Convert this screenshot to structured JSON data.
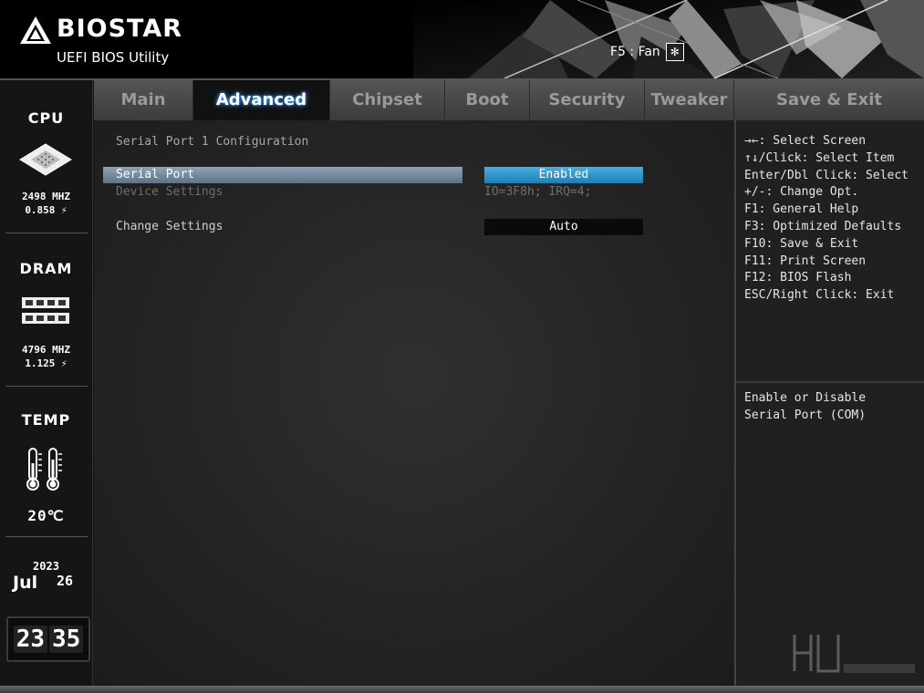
{
  "header": {
    "brand": "BIOSTAR",
    "subtitle": "UEFI BIOS Utility",
    "fan_label": "F5 : Fan"
  },
  "sidebar": {
    "cpu": {
      "label": "CPU",
      "freq": "2498 MHZ",
      "volt": "0.858 ⚡"
    },
    "dram": {
      "label": "DRAM",
      "freq": "4796 MHZ",
      "volt": "1.125 ⚡"
    },
    "temp": {
      "label": "TEMP",
      "value": "20℃"
    },
    "date": {
      "year": "2023",
      "month": "Jul",
      "day": "26"
    },
    "clock": {
      "hours": "23",
      "minutes": "35"
    }
  },
  "tabs": [
    {
      "label": "Main"
    },
    {
      "label": "Advanced"
    },
    {
      "label": "Chipset"
    },
    {
      "label": "Boot"
    },
    {
      "label": "Security"
    },
    {
      "label": "Tweaker"
    },
    {
      "label": "Save & Exit"
    }
  ],
  "main": {
    "section_title": "Serial Port 1 Configuration",
    "rows": [
      {
        "label": "Serial Port",
        "value": "Enabled"
      },
      {
        "label": "Device Settings",
        "value": "IO=3F8h; IRQ=4;"
      },
      {
        "label": "Change Settings",
        "value": "Auto"
      }
    ]
  },
  "help": {
    "keys": [
      "→←: Select Screen",
      "↑↓/Click: Select Item",
      "Enter/Dbl Click: Select",
      "+/-: Change Opt.",
      "F1: General Help",
      "F3: Optimized Defaults",
      "F10: Save & Exit",
      "F11: Print Screen",
      "F12: BIOS Flash",
      "ESC/Right Click: Exit"
    ],
    "description": [
      "Enable or Disable",
      "Serial Port (COM)"
    ]
  },
  "colors": {
    "accent_blue": "#2a8fcc",
    "selection_bar": "#7d92a8",
    "tab_glow": "#3aa0ff"
  }
}
